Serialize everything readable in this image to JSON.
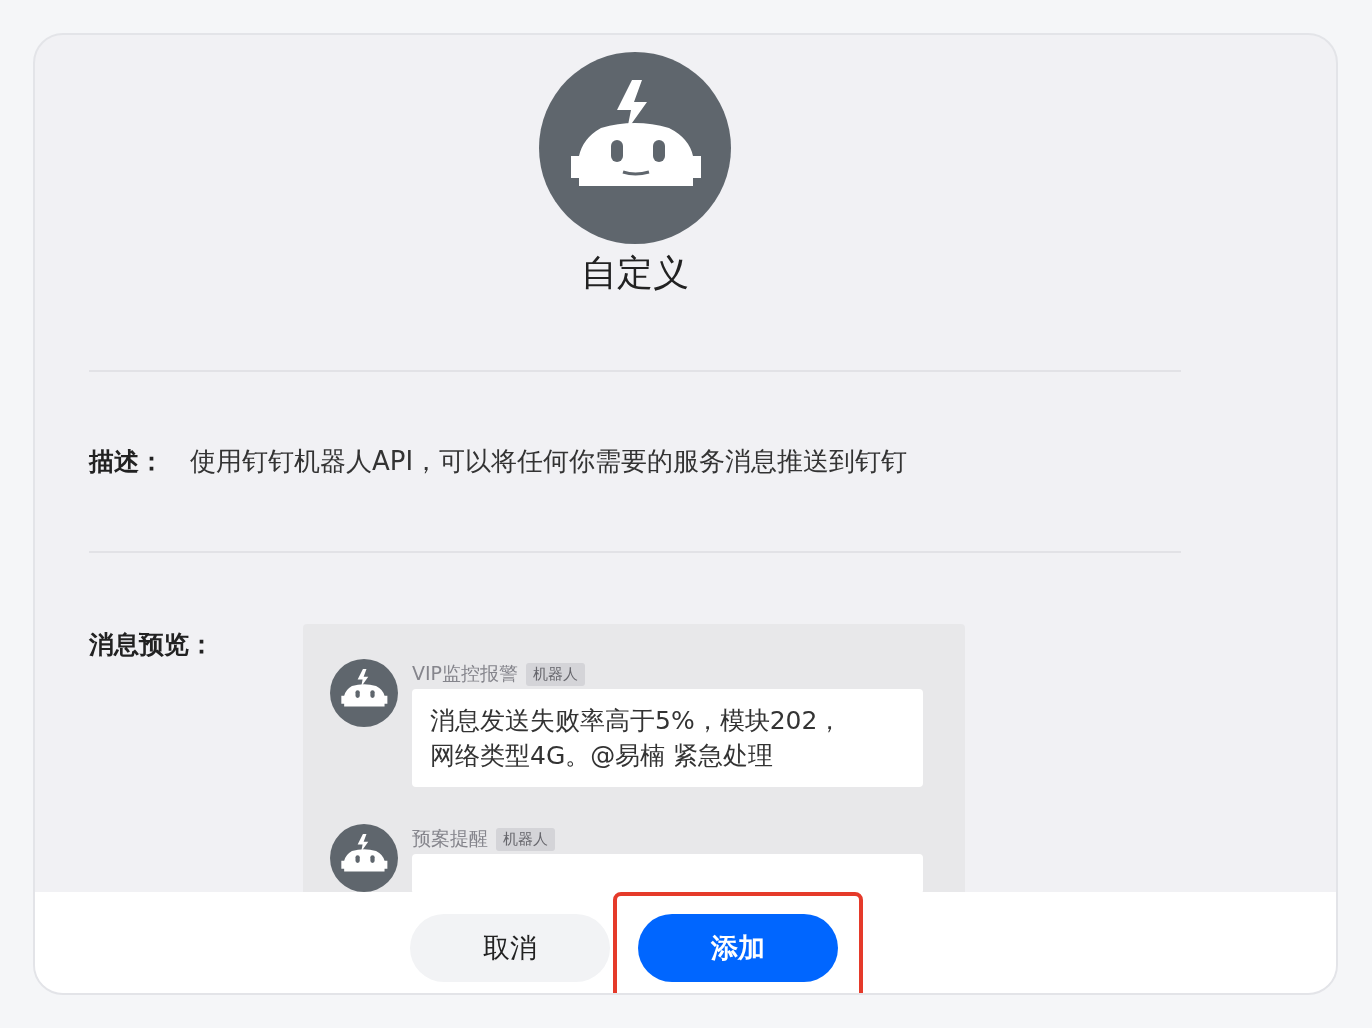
{
  "header": {
    "title": "自定义"
  },
  "description": {
    "label": "描述：",
    "text": "使用钉钉机器人API，可以将任何你需要的服务消息推送到钉钉"
  },
  "preview": {
    "label": "消息预览：",
    "messages": [
      {
        "sender": "VIP监控报警",
        "badge": "机器人",
        "text": "消息发送失败率高于5%，模块202，网络类型4G。@易楠 紧急处理"
      },
      {
        "sender": "预案提醒",
        "badge": "机器人"
      }
    ]
  },
  "buttons": [
    {
      "label": "取消",
      "kind": "secondary",
      "highlighted": false
    },
    {
      "label": "添加",
      "kind": "primary",
      "highlighted": true
    }
  ]
}
